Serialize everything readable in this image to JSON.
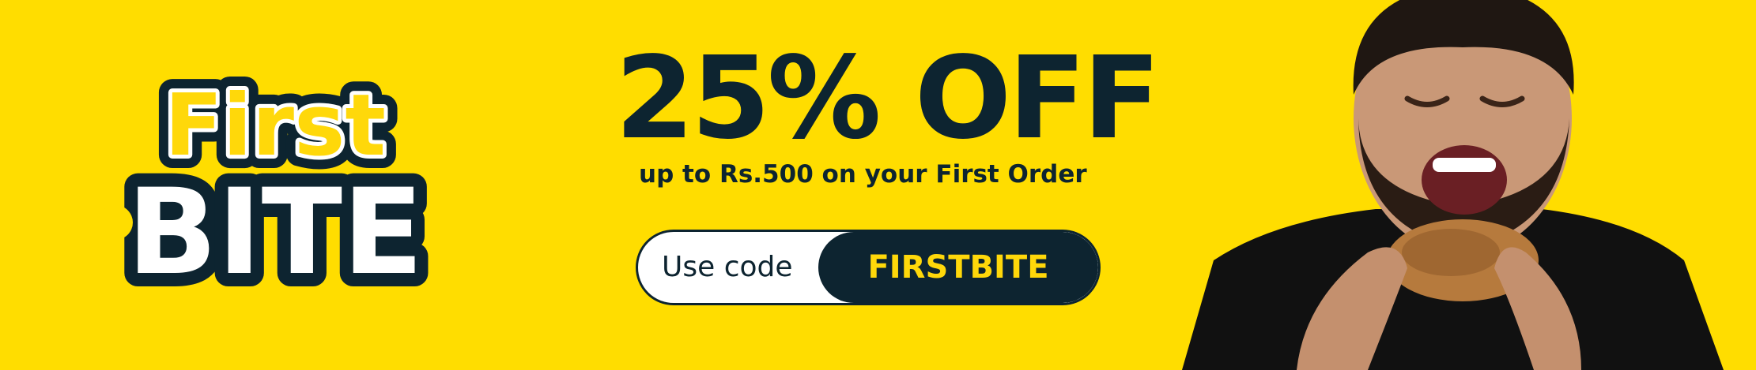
{
  "colors": {
    "background": "#ffdd00",
    "navy": "#0d2430",
    "logo_yellow": "#ffd80a",
    "white": "#ffffff",
    "shirt": "#111111",
    "skin": "#c99877",
    "hair": "#1f1712",
    "chicken": "#b67a3d"
  },
  "logo": {
    "line1": "First",
    "line2": "BITE"
  },
  "offer": {
    "headline": "25% OFF",
    "subtext_prefix": "up to Rs.500 on your",
    "subtext_emphasis": "First Order"
  },
  "promo": {
    "label": "Use code",
    "code": "FIRSTBITE"
  },
  "icons": {
    "person": "man-eating-fried-chicken-photo"
  }
}
